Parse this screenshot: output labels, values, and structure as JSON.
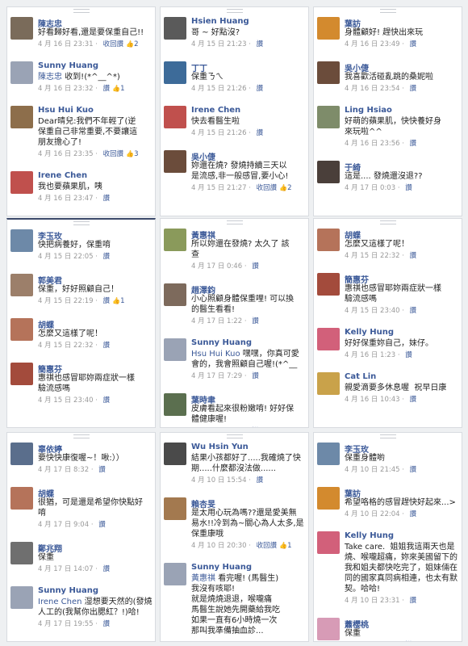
{
  "panels": [
    {
      "comments": [
        {
          "name": "陳志忠",
          "lines": [
            "好看歸好看,還是要保重自己!!"
          ],
          "meta": "4 月 16 日 23:31",
          "action": "收回讚",
          "likes": "2",
          "av": "#7a6b5a"
        },
        {
          "name": "Sunny Huang",
          "mention": "陳志忠",
          "lines": [
            "收到!(*^__^*)"
          ],
          "meta": "4 月 16 日 23:32",
          "action": "讚",
          "likes": "1",
          "av": "#9aa3b5"
        },
        {
          "name": "Hsu Hui Kuo",
          "lines": [
            "Dear晴兒:我們不年輕了(逆",
            "保重自己非常重要,不要讓這",
            "朋友擔心了!"
          ],
          "meta": "4 月 16 日 23:35",
          "action": "收回讚",
          "likes": "3",
          "av": "#8d6e4b"
        },
        {
          "name": "Irene Chen",
          "lines": [
            "我也要蘋果肌，咦"
          ],
          "meta": "4 月 16 日 23:47",
          "action": "讚",
          "likes": "",
          "av": "#c0504d"
        }
      ]
    },
    {
      "comments": [
        {
          "name": "Hsien Huang",
          "lines": [
            "哥 ~ 好點沒?"
          ],
          "meta": "4 月 15 日 21:23",
          "action": "讚",
          "likes": "",
          "av": "#5a5a5a"
        },
        {
          "name": "丁丁",
          "lines": [
            "保重ㄋㄟ"
          ],
          "meta": "4 月 15 日 21:26",
          "action": "讚",
          "likes": "",
          "av": "#3d6b99"
        },
        {
          "name": "Irene Chen",
          "lines": [
            "快去看醫生啦"
          ],
          "meta": "4 月 15 日 21:26",
          "action": "讚",
          "likes": "",
          "av": "#c0504d"
        },
        {
          "name": "吳小倢",
          "lines": [
            "妳還在燒? 發燒持續三天以",
            "是流感,非一般感冒,要小心!"
          ],
          "meta": "4 月 15 日 21:27",
          "action": "收回讚",
          "likes": "2",
          "av": "#6b4c3b"
        }
      ]
    },
    {
      "comments": [
        {
          "name": "葉訪",
          "lines": [
            "身體顧好! 趕快出來玩"
          ],
          "meta": "4 月 16 日 23:49",
          "action": "讚",
          "likes": "",
          "av": "#d38a2e"
        },
        {
          "name": "吳小倢",
          "lines": [
            "我喜歡活碰亂跳的桑妮啦"
          ],
          "meta": "4 月 16 日 23:54",
          "action": "讚",
          "likes": "",
          "av": "#6b4c3b"
        },
        {
          "name": "Ling Hsiao",
          "lines": [
            "好萌的蘋果肌，快快養好身",
            "來玩啦^^"
          ],
          "meta": "4 月 16 日 23:56",
          "action": "讚",
          "likes": "",
          "av": "#7e8c6a"
        },
        {
          "name": "于綺",
          "lines": [
            "這是.... 發燒還沒退??"
          ],
          "meta": "4 月 17 日 0:03",
          "action": "讚",
          "likes": "",
          "av": "#4a3f3a"
        }
      ]
    },
    {
      "comments": [
        {
          "name": "李玉玫",
          "lines": [
            "快把病養好，保重唷"
          ],
          "meta": "4 月 15 日 22:05",
          "action": "讚",
          "likes": "",
          "av": "#6d89a8"
        },
        {
          "name": "郭美君",
          "lines": [
            "保重，好好照顧自己！"
          ],
          "meta": "4 月 15 日 22:19",
          "action": "讚",
          "likes": "1",
          "av": "#9c7f6a"
        },
        {
          "name": "胡蝶",
          "lines": [
            "怎麼又這樣了呢！"
          ],
          "meta": "4 月 15 日 22:32",
          "action": "讚",
          "likes": "",
          "av": "#b5735a"
        },
        {
          "name": "簡惠芬",
          "lines": [
            "惠祺也感冒耶妳兩症狀一樣",
            "驗流感嗎"
          ],
          "meta": "4 月 15 日 23:40",
          "action": "讚",
          "likes": "",
          "av": "#a34b3c"
        }
      ]
    },
    {
      "comments": [
        {
          "name": "黃惠祺",
          "lines": [
            "所以妳還在發燒? 太久了 該",
            "查"
          ],
          "meta": "4 月 17 日 0:46",
          "action": "讚",
          "likes": "",
          "av": "#8a9a5b"
        },
        {
          "name": "趙澤鈞",
          "lines": [
            "小心照顧身體保重哩! 可以換",
            "的醫生看看!"
          ],
          "meta": "4 月 17 日 1:22",
          "action": "讚",
          "likes": "",
          "av": "#7d6a5c"
        },
        {
          "name": "Sunny Huang",
          "mention": "Hsu Hui Kuo",
          "lines": [
            "嘿嘿，你真可愛",
            "會的，我會照顧自己喔!(*^__"
          ],
          "meta": "4 月 17 日 7:29",
          "action": "讚",
          "likes": "",
          "av": "#9aa3b5"
        },
        {
          "name": "葉時聿",
          "lines": [
            "皮膚看起來很粉嫩唷! 好好保",
            "體健康喔!"
          ],
          "meta": "4 月 17 日 9:01",
          "action": "讚",
          "likes": "",
          "av": "#5b6f4f"
        }
      ]
    },
    {
      "comments": [
        {
          "name": "胡蝶",
          "lines": [
            "怎麼又這樣了呢！"
          ],
          "meta": "4 月 15 日 22:32",
          "action": "讚",
          "likes": "",
          "av": "#b5735a"
        },
        {
          "name": "簡惠芬",
          "lines": [
            "惠祺也感冒耶妳兩症狀一樣",
            "驗流感嗎"
          ],
          "meta": "4 月 15 日 23:40",
          "action": "讚",
          "likes": "",
          "av": "#a34b3c"
        },
        {
          "name": "Kelly  Hung",
          "lines": [
            "好好保重妳自己，妹仔。"
          ],
          "meta": "4 月 16 日 1:23",
          "action": "讚",
          "likes": "",
          "av": "#d2607a"
        },
        {
          "name": "Cat Lin",
          "lines": [
            "親愛滴要多休息喔  祝早日康"
          ],
          "meta": "4 月 16 日 10:43",
          "action": "讚",
          "likes": "",
          "av": "#c9a24a"
        }
      ]
    },
    {
      "comments": [
        {
          "name": "辜依婷",
          "lines": [
            "要快快康復喔~！啾:））"
          ],
          "meta": "4 月 17 日 8:32",
          "action": "讚",
          "likes": "",
          "av": "#5a6e8c"
        },
        {
          "name": "胡蝶",
          "lines": [
            "很猶，可是還是希望你快點好",
            "唷"
          ],
          "meta": "4 月 17 日 9:04",
          "action": "讚",
          "likes": "",
          "av": "#b5735a"
        },
        {
          "name": "鄭兆翔",
          "lines": [
            "保重"
          ],
          "meta": "4 月 17 日 14:07",
          "action": "讚",
          "likes": "",
          "av": "#6f6f6f"
        },
        {
          "name": "Sunny Huang",
          "mention": "Irene Chen",
          "lines": [
            "湿想要天然的(發燒",
            "人工的(我幫你出腮紅？!)哈!"
          ],
          "meta": "4 月 17 日 19:55",
          "action": "讚",
          "likes": "",
          "av": "#9aa3b5"
        }
      ]
    },
    {
      "comments": [
        {
          "name": "Wu Hsin Yun",
          "lines": [
            "結果小孩都好了.....我確燒了快",
            "期.....什麼都沒法做......"
          ],
          "meta": "4 月 10 日 15:54",
          "action": "讚",
          "likes": "",
          "av": "#4a4a4a"
        },
        {
          "name": "賴杏旻",
          "lines": [
            "是太用心玩為嗎??還是愛美無",
            "易水!!冷到為~關心為人太多,是",
            "保重康哦"
          ],
          "meta": "4 月 10 日 20:30",
          "action": "收回讚",
          "likes": "1",
          "av": "#a3794f"
        },
        {
          "name": "Sunny Huang",
          "mention": "黃惠祺",
          "lines": [
            "看完喔! (馬醫生)",
            "我沒有咳耶!",
            "就是燒燒退退，喉嚨痛",
            "馬醫生說她先開藥給我吃",
            "如果一直有6小時燒一次",
            "那叫我準備抽血診..."
          ],
          "meta": "",
          "action": "",
          "likes": "",
          "av": "#9aa3b5"
        }
      ]
    },
    {
      "comments": [
        {
          "name": "李玉玫",
          "lines": [
            "保重身體喲"
          ],
          "meta": "4 月 10 日 21:45",
          "action": "讚",
          "likes": "",
          "av": "#6d89a8"
        },
        {
          "name": "葉訪",
          "lines": [
            "希望咯格的感冒趕快好起來...>"
          ],
          "meta": "4 月 10 日 22:04",
          "action": "讚",
          "likes": "",
          "av": "#d38a2e"
        },
        {
          "name": "Kelly  Hung",
          "lines": [
            "Take care.  姐姐我這兩天也是",
            "燒、喉嚨超痛，妳來美國留下的",
            "我和姐夫都快吃完了，姐妹倆在",
            "同的國家真同病相連，也太有默",
            "契。哈哈!"
          ],
          "meta": "4 月 10 日 23:31",
          "action": "讚",
          "likes": "",
          "av": "#d2607a"
        },
        {
          "name": "蕭櫻桃",
          "lines": [
            "保重"
          ],
          "meta": "4 月 11 日 7:46",
          "action": "讚",
          "likes": "",
          "av": "#d79bb6"
        }
      ]
    }
  ]
}
